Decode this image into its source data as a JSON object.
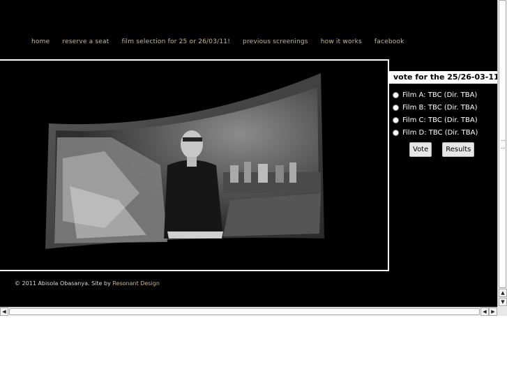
{
  "nav": {
    "items": [
      {
        "label": "home"
      },
      {
        "label": "reserve a seat"
      },
      {
        "label": "film selection for 25 or 26/03/11!"
      },
      {
        "label": "previous screenings"
      },
      {
        "label": "how it works"
      },
      {
        "label": "facebook"
      }
    ]
  },
  "hero": {
    "image_alt": "Black and white photograph of a man seated in a cluttered artist studio"
  },
  "poll": {
    "title": "vote for the 25/26-03-11",
    "options": [
      {
        "label": "Film A: TBC (Dir. TBA)"
      },
      {
        "label": "Film B: TBC (Dir. TBA)"
      },
      {
        "label": "Film C: TBC (Dir. TBA)"
      },
      {
        "label": "Film D: TBC (Dir. TBA)"
      }
    ],
    "vote_label": "Vote",
    "results_label": "Results"
  },
  "footer": {
    "copyright": "© 2011 Abisola Obasanya. Site by",
    "designer": "Resonant Design"
  },
  "colors": {
    "background": "#000000",
    "nav_link": "#c9b98c",
    "poll_title_bg": "#ffffff"
  }
}
